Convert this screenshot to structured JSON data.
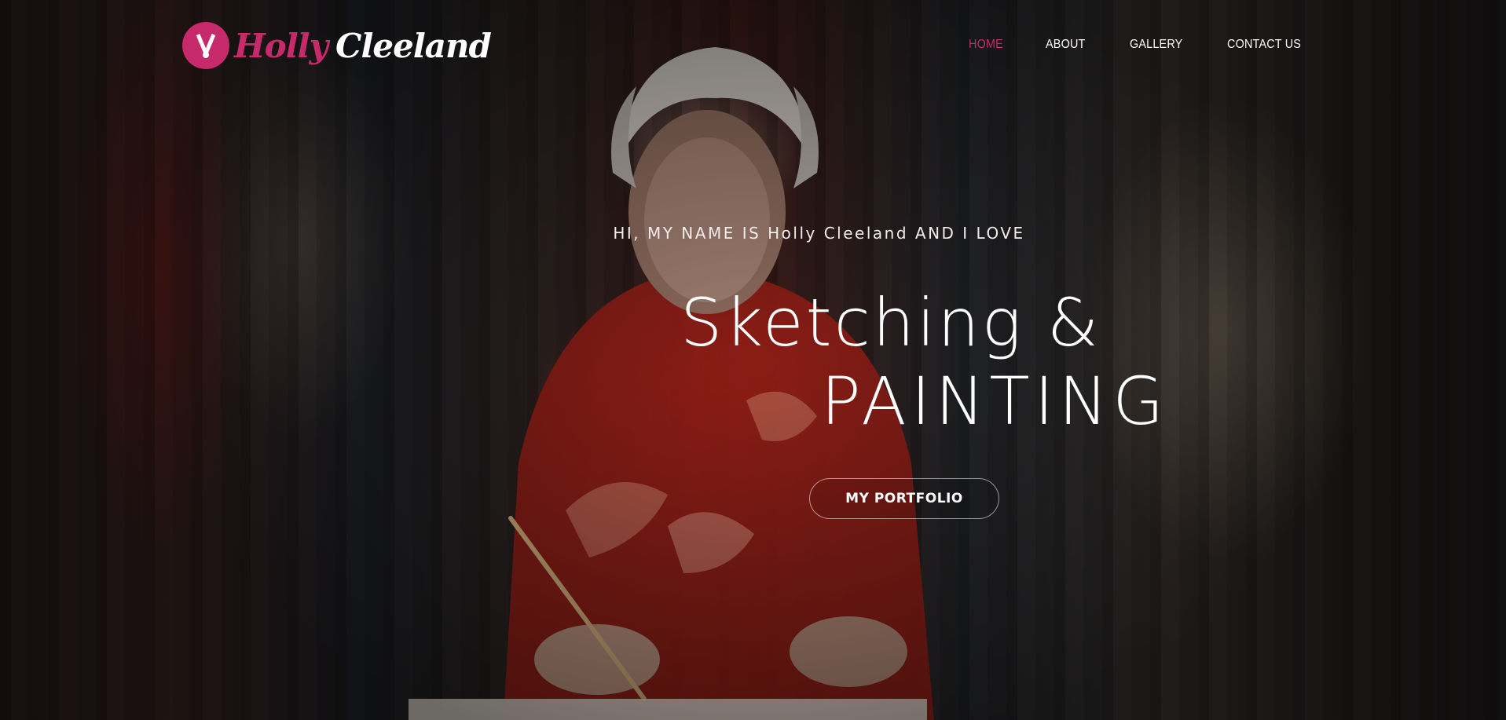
{
  "brand": {
    "first_name": "Holly",
    "last_name": "Cleeland",
    "accent_color": "#c72a6a"
  },
  "nav": {
    "items": [
      {
        "label": "HOME",
        "active": true
      },
      {
        "label": "ABOUT",
        "active": false
      },
      {
        "label": "GALLERY",
        "active": false
      },
      {
        "label": "CONTACT US",
        "active": false
      }
    ]
  },
  "hero": {
    "tagline": "HI, MY NAME IS Holly Cleeland AND I LOVE",
    "headline_line1": "Sketching &",
    "headline_line2": "PAINTING",
    "cta_label": "MY PORTFOLIO",
    "background": "painting of elderly woman in red floral robe writing calligraphy"
  }
}
